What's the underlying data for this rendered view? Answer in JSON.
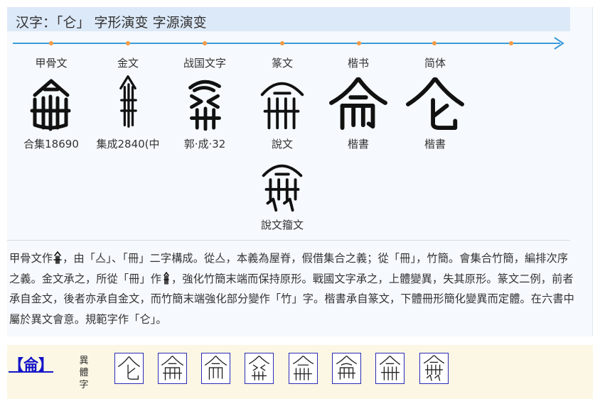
{
  "title": "汉字：「仑」 字形演变 字源演变",
  "stages": [
    {
      "label": "甲骨文",
      "source": "合集18690"
    },
    {
      "label": "金文",
      "source": "集成2840(中"
    },
    {
      "label": "战国文字",
      "source": "郭·成·32"
    },
    {
      "label": "篆文",
      "source": "說文"
    },
    {
      "label": "楷书",
      "source": "楷書"
    },
    {
      "label": "简体",
      "source": "楷書"
    }
  ],
  "extra_source": "說文籀文",
  "description": {
    "p1": "甲骨文作",
    "p2": "，由「亼」、「冊」二字構成。從亼，本義為屋脊，假借集合之義；從「冊」，竹簡。會集合竹簡，編排次序之義。金文承之，所從「冊」作",
    "p3": "，強化竹簡末端而保持原形。戰國文字承之，上體變異，失其原形。篆文二例，前者承自金文，後者亦承自金文，而竹簡末端強化部分變作「竹」字。楷書承自篆文，下體冊形簡化變異而定體。在六書中屬於異文會意。規範字作「仑」。"
  },
  "variants": {
    "char_link": "【侖】",
    "label": "異體字",
    "count": 8
  },
  "colors": {
    "timeline": "#3a9bd9",
    "dot": "#f29a45",
    "link": "#1414c8",
    "header_bg": "#dce9f8",
    "panel_bg": "#f6f9fd",
    "variant_bg": "#fbf7e4",
    "variant_border": "#2b2bb5"
  }
}
